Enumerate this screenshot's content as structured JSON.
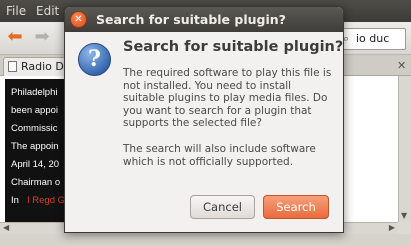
{
  "browser": {
    "menu": {
      "file": "File",
      "edit": "Edit"
    },
    "search_text": "io duc",
    "tab_label": "Radio Du",
    "article_lines": [
      "Philadelphi",
      "been appoi",
      "Commissic",
      "The appoin",
      "April 14, 20",
      "Chairman o",
      "In"
    ],
    "article_link": "I Regd G"
  },
  "dialog": {
    "title": "Search for suitable plugin?",
    "heading": "Search for suitable plugin?",
    "body_lines": [
      "The required software to play this file is",
      "not installed. You need to install",
      "suitable plugins to play media files. Do",
      "you want to search for a plugin that",
      "supports the selected file?"
    ],
    "body_lines_2": [
      "The search will also include software",
      "which is not officially supported."
    ],
    "cancel_label": "Cancel",
    "search_label": "Search",
    "icon": "question-icon"
  },
  "colors": {
    "accent": "#ea6a3c",
    "titlebar": "#3e3d39",
    "info_blue": "#3768b0"
  }
}
